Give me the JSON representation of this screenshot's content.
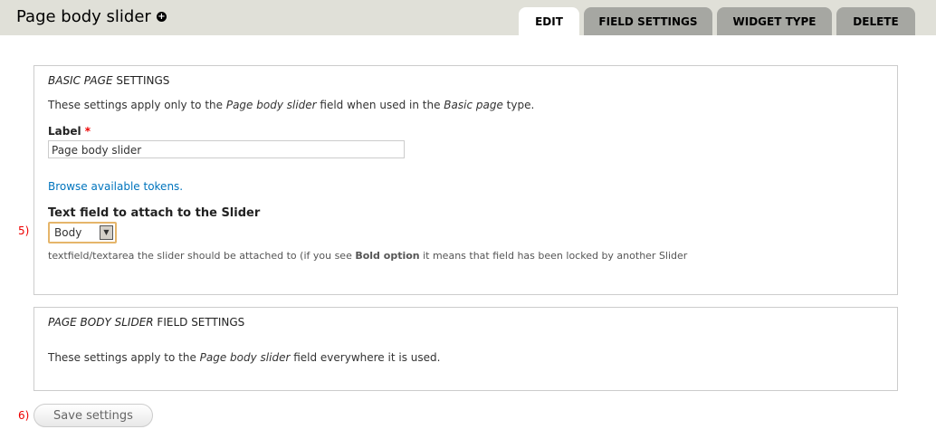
{
  "header": {
    "title": "Page body slider",
    "add_icon": "plus-circle-icon"
  },
  "tabs": [
    {
      "label": "EDIT"
    },
    {
      "label": "FIELD SETTINGS"
    },
    {
      "label": "WIDGET TYPE"
    },
    {
      "label": "DELETE"
    }
  ],
  "basic": {
    "legend_em": "Basic page",
    "legend_rest": " settings",
    "desc_pre": "These settings apply only to the ",
    "desc_em1": "Page body slider",
    "desc_mid": " field when used in the ",
    "desc_em2": "Basic page",
    "desc_post": " type.",
    "label": "Label",
    "required": "*",
    "label_value": "Page body slider",
    "tokens_link": "Browse available tokens.",
    "select_label": "Text field to attach to the Slider",
    "select_value": "Body",
    "select_desc_pre": "textfield/textarea the slider should be attached to (if you see ",
    "select_desc_bold": "Bold option",
    "select_desc_post": " it means that field has been locked by another Slider"
  },
  "field": {
    "legend_em": "Page body slider",
    "legend_rest": " field settings",
    "desc_pre": "These settings apply to the ",
    "desc_em": "Page body slider",
    "desc_post": " field everywhere it is used."
  },
  "annotations": {
    "n5": "5)",
    "n6": "6)"
  },
  "save_label": "Save settings"
}
